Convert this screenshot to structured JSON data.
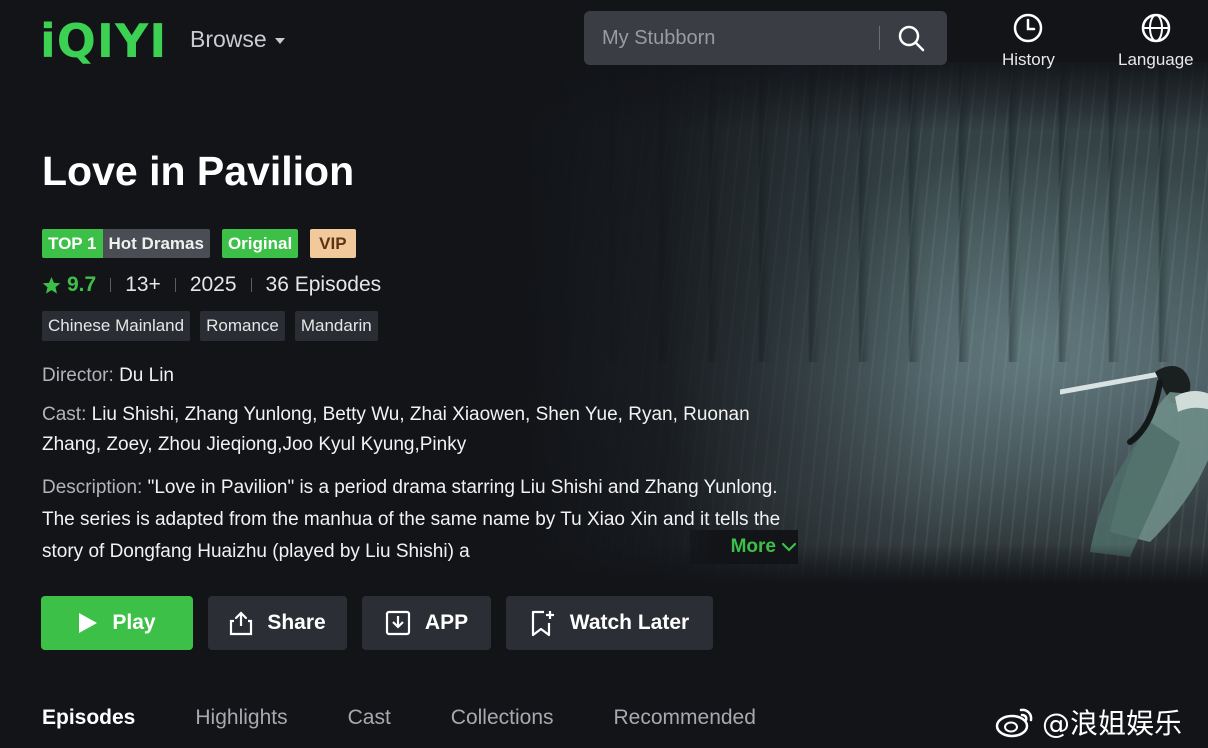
{
  "header": {
    "logo": "iQIYI",
    "browse_label": "Browse",
    "search_placeholder": "My Stubborn",
    "history_label": "History",
    "language_label": "Language"
  },
  "show": {
    "title": "Love in Pavilion",
    "tags": {
      "top": "TOP 1",
      "hot": "Hot Dramas",
      "original": "Original",
      "vip": "VIP"
    },
    "rating": "9.7",
    "age": "13+",
    "year": "2025",
    "episodes": "36 Episodes",
    "genres": [
      "Chinese Mainland",
      "Romance",
      "Mandarin"
    ],
    "director_label": "Director:",
    "director": "Du Lin",
    "cast_label": "Cast:",
    "cast": "Liu Shishi, Zhang Yunlong, Betty Wu, Zhai Xiaowen, Shen Yue, Ryan, Ruonan Zhang, Zoey, Zhou Jieqiong,Joo Kyul Kyung,Pinky",
    "description_label": "Description:",
    "description": "\"Love in Pavilion\" is a period drama starring Liu Shishi and Zhang Yunlong. The series is adapted from the manhua of the same name by Tu Xiao Xin and it tells the story of Dongfang Huaizhu (played by Liu Shishi) a",
    "more_label": "More"
  },
  "actions": {
    "play": "Play",
    "share": "Share",
    "app": "APP",
    "watch_later": "Watch Later"
  },
  "tabs": [
    "Episodes",
    "Highlights",
    "Cast",
    "Collections",
    "Recommended"
  ],
  "watermark": "@浪姐娱乐",
  "colors": {
    "accent": "#3dc048",
    "vip_bg": "#f2c99b",
    "background": "#121418"
  }
}
